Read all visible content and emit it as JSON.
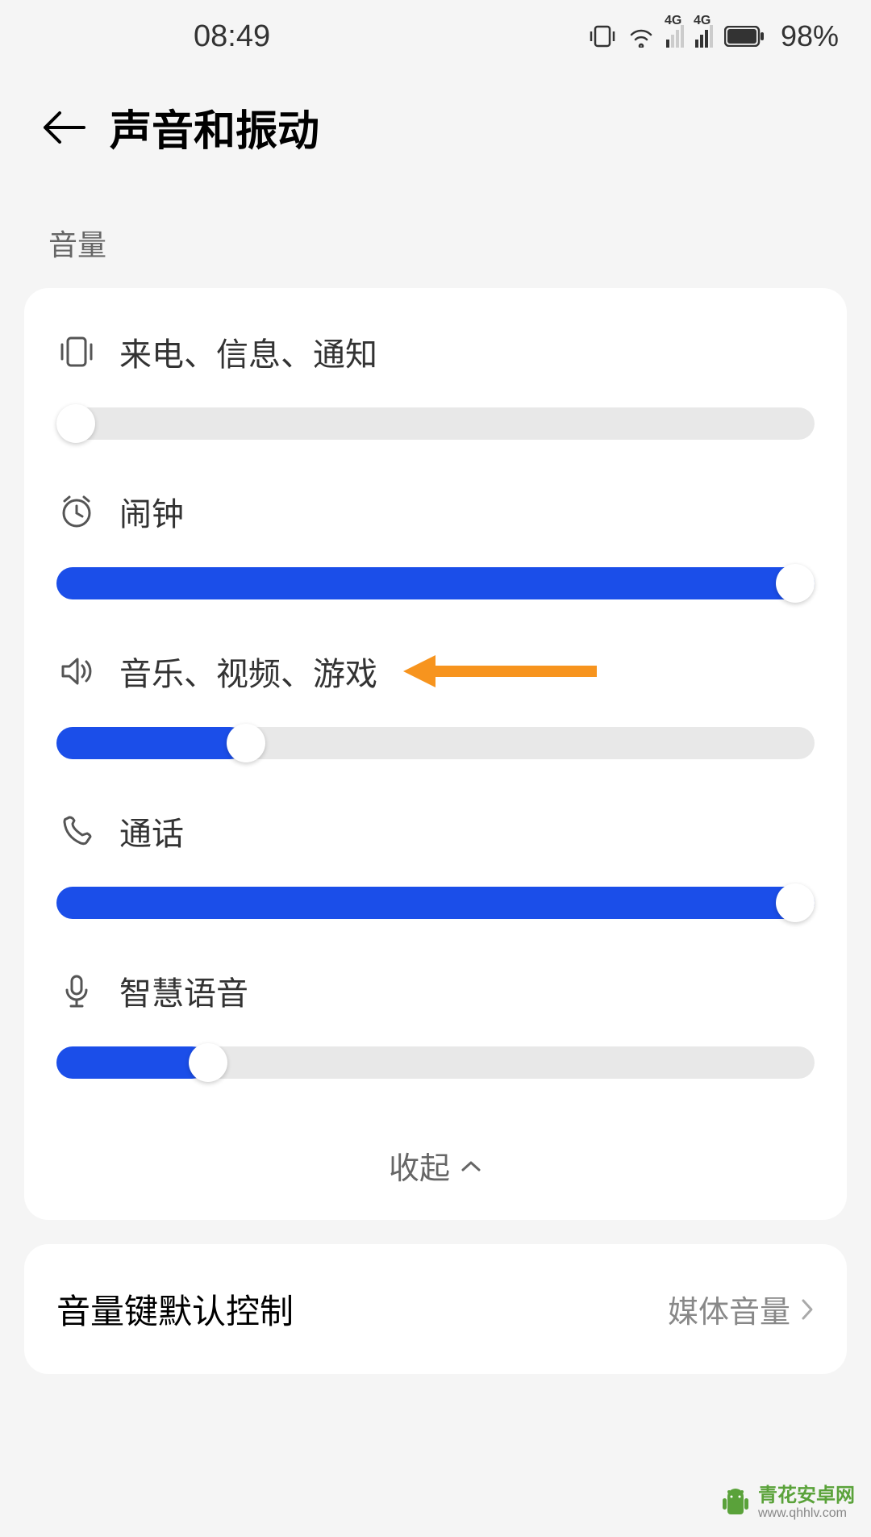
{
  "status": {
    "time": "08:49",
    "battery": "98%"
  },
  "header": {
    "title": "声音和振动"
  },
  "section": {
    "volume_label": "音量"
  },
  "sliders": {
    "ringtone": {
      "label": "来电、信息、通知",
      "value": 0
    },
    "alarm": {
      "label": "闹钟",
      "value": 100
    },
    "media": {
      "label": "音乐、视频、游戏",
      "value": 25
    },
    "call": {
      "label": "通话",
      "value": 100
    },
    "voice": {
      "label": "智慧语音",
      "value": 20
    }
  },
  "collapse": {
    "label": "收起"
  },
  "setting": {
    "vol_key_default": {
      "label": "音量键默认控制",
      "value": "媒体音量"
    }
  },
  "watermark": {
    "name": "青花安卓网",
    "url": "www.qhhlv.com"
  }
}
